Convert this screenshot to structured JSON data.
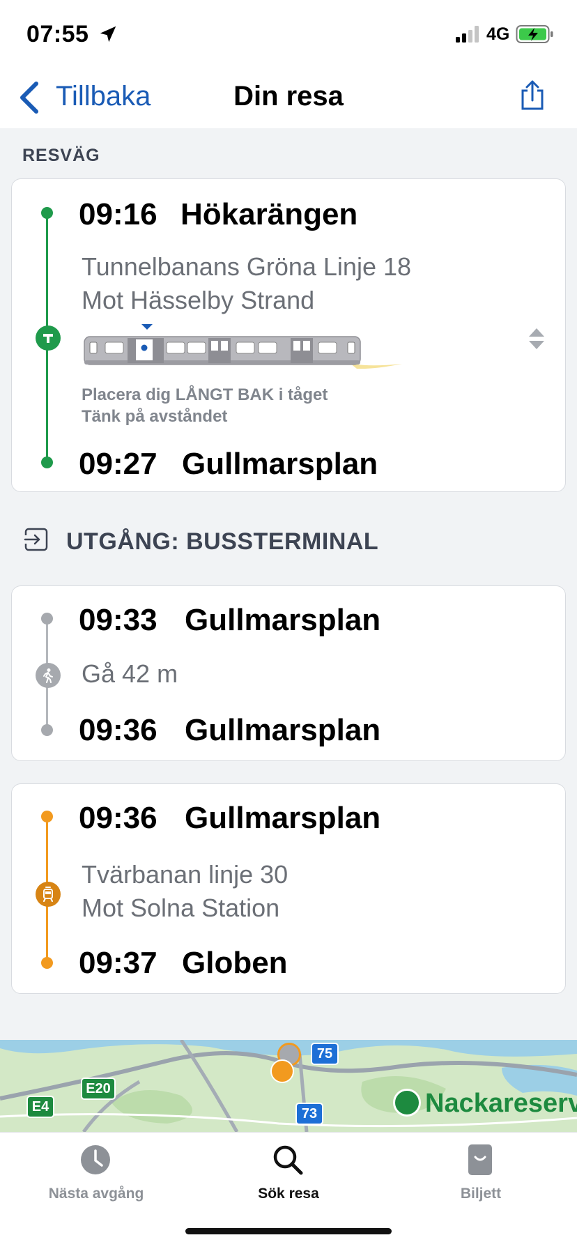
{
  "status_bar": {
    "time": "07:55",
    "network": "4G",
    "icons": [
      "location-arrow-icon",
      "signal-icon",
      "battery-charging-icon"
    ]
  },
  "nav": {
    "back_label": "Tillbaka",
    "title": "Din resa",
    "share_icon": "share-icon"
  },
  "section_label": "RESVÄG",
  "legs": [
    {
      "mode": "metro",
      "color": "#1f9a4b",
      "badge_icon": "metro-icon",
      "depart_time": "09:16",
      "depart_station": "Hökarängen",
      "line": "Tunnelbanans Gröna Linje 18",
      "direction": "Mot Hässelby Strand",
      "hint_1": "Placera dig LÅNGT BAK i tåget",
      "hint_2": "Tänk på avståndet",
      "arrive_time": "09:27",
      "arrive_station": "Gullmarsplan"
    },
    {
      "mode": "walk",
      "color": "#9ea2a8",
      "badge_icon": "walk-icon",
      "depart_time": "09:33",
      "depart_station": "Gullmarsplan",
      "walk_text": "Gå 42 m",
      "arrive_time": "09:36",
      "arrive_station": "Gullmarsplan"
    },
    {
      "mode": "tram",
      "color": "#f29a1f",
      "badge_icon": "tram-icon",
      "depart_time": "09:36",
      "depart_station": "Gullmarsplan",
      "line": "Tvärbanan linje 30",
      "direction": "Mot Solna Station",
      "arrive_time": "09:37",
      "arrive_station": "Globen"
    }
  ],
  "exit": {
    "label": "UTGÅNG: BUSSTERMINAL",
    "icon": "exit-icon"
  },
  "map": {
    "labels": [
      "E20",
      "E4",
      "75",
      "73",
      "Nackareserv"
    ]
  },
  "tabs": [
    {
      "label": "Nästa avgång",
      "icon": "clock-icon",
      "active": false
    },
    {
      "label": "Sök resa",
      "icon": "search-icon",
      "active": true
    },
    {
      "label": "Biljett",
      "icon": "ticket-icon",
      "active": false
    }
  ]
}
